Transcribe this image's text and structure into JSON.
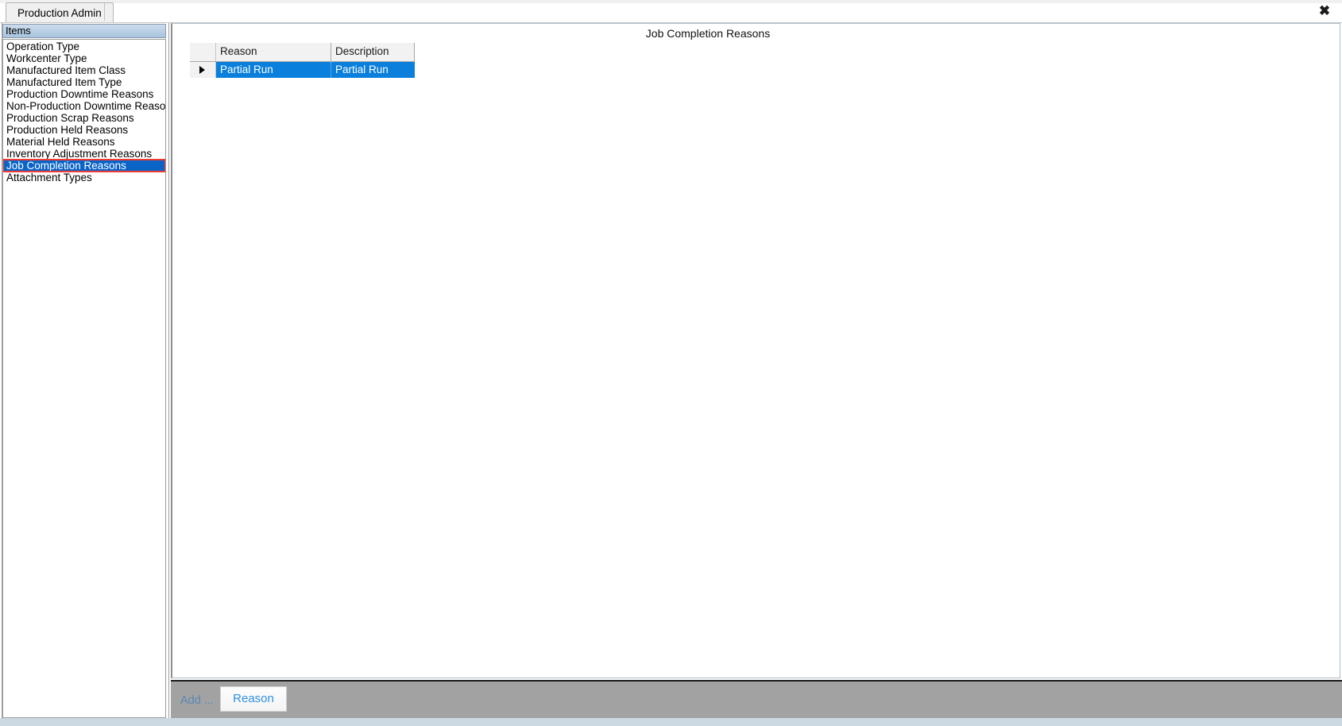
{
  "window": {
    "close_icon": "close-icon",
    "close_glyph": "✖"
  },
  "tabs": [
    {
      "label": "Production Admin",
      "active": true
    }
  ],
  "sidebar": {
    "header": "Items",
    "items": [
      {
        "label": "Operation Type",
        "selected": false
      },
      {
        "label": "Workcenter Type",
        "selected": false
      },
      {
        "label": "Manufactured Item Class",
        "selected": false
      },
      {
        "label": "Manufactured Item Type",
        "selected": false
      },
      {
        "label": "Production Downtime Reasons",
        "selected": false
      },
      {
        "label": "Non-Production Downtime Reasons",
        "selected": false
      },
      {
        "label": "Production Scrap Reasons",
        "selected": false
      },
      {
        "label": "Production Held Reasons",
        "selected": false
      },
      {
        "label": "Material Held Reasons",
        "selected": false
      },
      {
        "label": "Inventory Adjustment Reasons",
        "selected": false
      },
      {
        "label": "Job Completion Reasons",
        "selected": true
      },
      {
        "label": "Attachment Types",
        "selected": false
      }
    ]
  },
  "main": {
    "title": "Job Completion Reasons",
    "grid": {
      "columns": [
        "Reason",
        "Description"
      ],
      "rows": [
        {
          "selected": true,
          "indicator": "row-selector-arrow",
          "Reason": "Partial Run",
          "Description": "Partial Run"
        }
      ]
    }
  },
  "toolbar": {
    "add_label": "Add ...",
    "reason_button": "Reason"
  },
  "colors": {
    "selection_blue": "#0a7fdc",
    "sidebar_selection_blue": "#0a64c8",
    "highlight_red": "#ef3b33",
    "toolbar_gray": "#a2a2a2",
    "button_blue_text": "#2f8fe0",
    "add_label_blue": "#5b87b4"
  }
}
